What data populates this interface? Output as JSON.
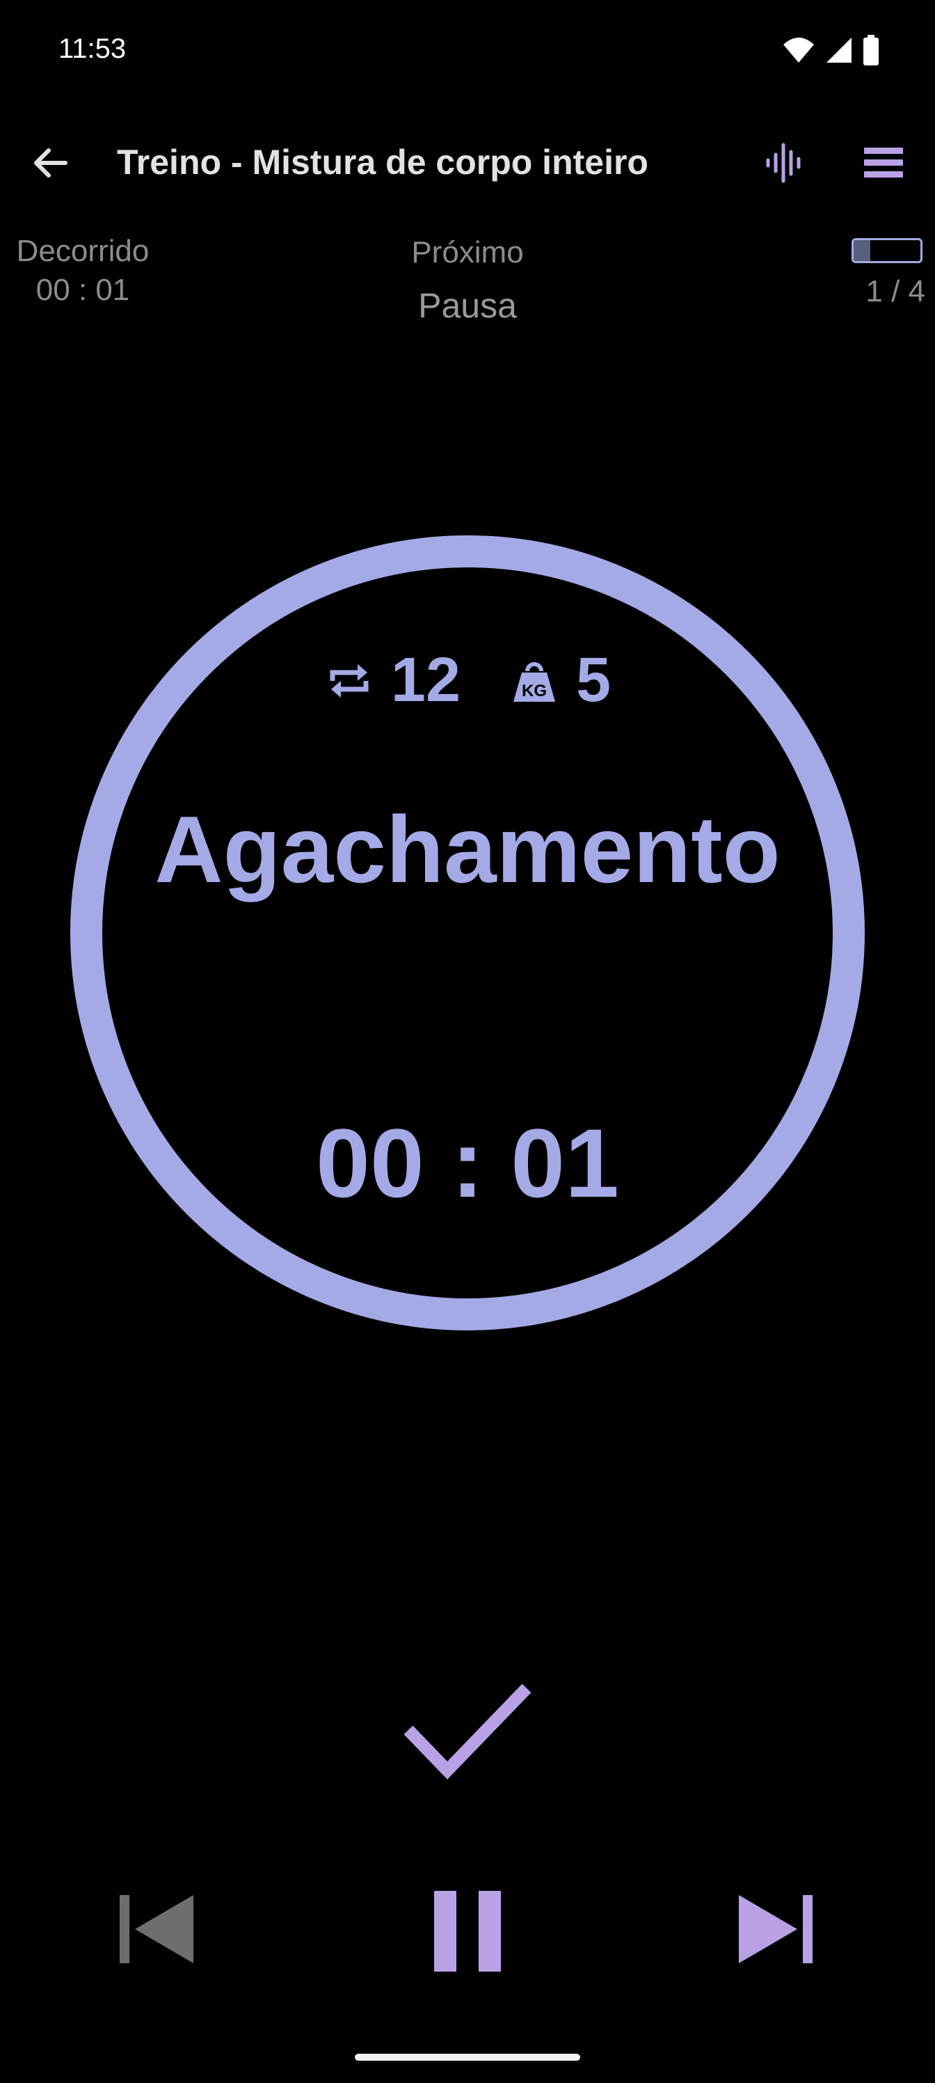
{
  "status_bar": {
    "time": "11:53",
    "icons": [
      "wifi-icon",
      "signal-icon",
      "battery-icon"
    ]
  },
  "app_bar": {
    "title": "Treino - Mistura de corpo inteiro",
    "back_icon": "arrow-left-icon",
    "voice_icon": "audio-wave-icon",
    "menu_icon": "list-menu-icon"
  },
  "info": {
    "elapsed_label": "Decorrido",
    "elapsed_value": "00 : 01",
    "next_label": "Próximo",
    "next_value": "Pausa",
    "progress": {
      "count": "1 / 4",
      "fraction": 0.25
    }
  },
  "exercise": {
    "reps": "12",
    "weight": "5",
    "reps_icon": "repeat-icon",
    "weight_icon": "kettlebell-kg-icon",
    "name": "Agachamento",
    "timer": "00 : 01"
  },
  "controls": {
    "complete_icon": "check-icon",
    "previous_icon": "skip-previous-icon",
    "pause_icon": "pause-icon",
    "next_icon": "skip-next-icon"
  },
  "colors": {
    "background": "#000000",
    "accent": "#a3aae6",
    "secondary_accent": "#b9a1e6",
    "muted_text": "#8c8c8c",
    "disabled_control": "#6e6e6e"
  }
}
